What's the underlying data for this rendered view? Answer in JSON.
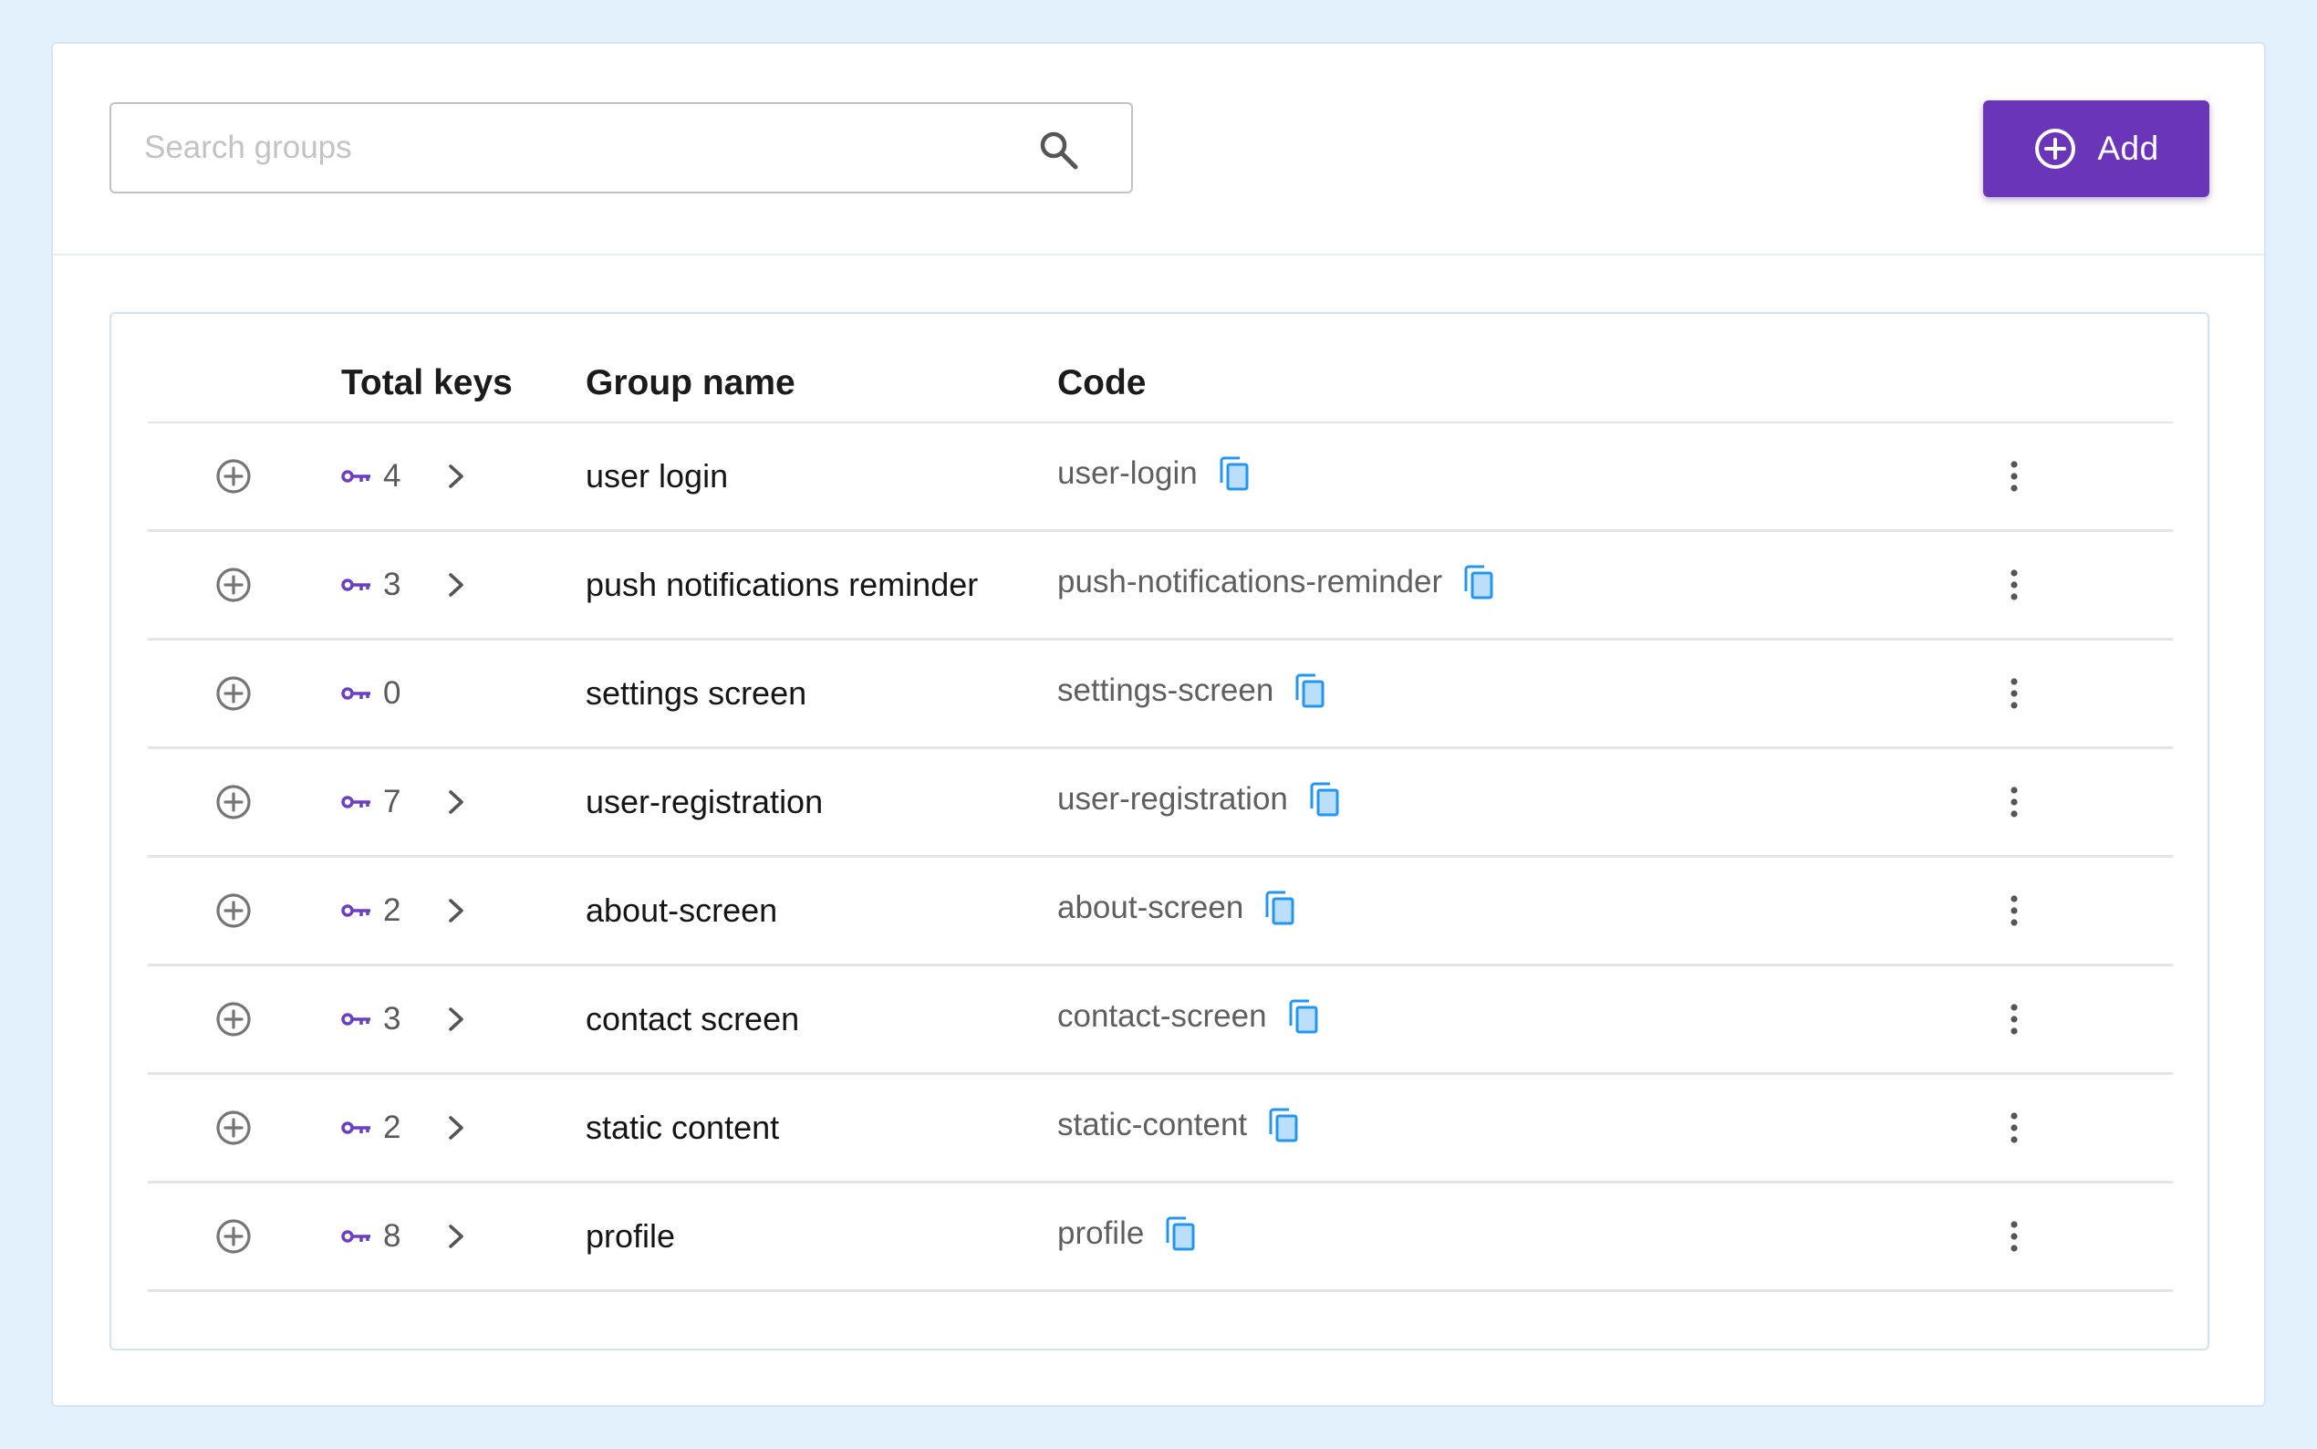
{
  "search": {
    "placeholder": "Search groups",
    "value": ""
  },
  "toolbar": {
    "add_label": "Add"
  },
  "colors": {
    "accent": "#6a35b8",
    "key_icon": "#6b3fc4",
    "copy_icon": "#2196f3",
    "background": "#e3f1fc"
  },
  "table": {
    "headers": {
      "total_keys": "Total keys",
      "group_name": "Group name",
      "code": "Code"
    },
    "rows": [
      {
        "total_keys": "4",
        "has_keys": true,
        "group_name": "user login",
        "code": "user-login"
      },
      {
        "total_keys": "3",
        "has_keys": true,
        "group_name": "push notifications reminder",
        "code": "push-notifications-reminder"
      },
      {
        "total_keys": "0",
        "has_keys": false,
        "group_name": "settings screen",
        "code": "settings-screen"
      },
      {
        "total_keys": "7",
        "has_keys": true,
        "group_name": "user-registration",
        "code": "user-registration"
      },
      {
        "total_keys": "2",
        "has_keys": true,
        "group_name": "about-screen",
        "code": "about-screen"
      },
      {
        "total_keys": "3",
        "has_keys": true,
        "group_name": "contact screen",
        "code": "contact-screen"
      },
      {
        "total_keys": "2",
        "has_keys": true,
        "group_name": "static content",
        "code": "static-content"
      },
      {
        "total_keys": "8",
        "has_keys": true,
        "group_name": "profile",
        "code": "profile"
      }
    ]
  },
  "icons": {
    "search": "search-icon",
    "add": "plus-circle-icon",
    "expand": "plus-circle-icon",
    "keys": "key-icon",
    "open": "chevron-right-icon",
    "copy": "copy-icon",
    "more": "more-vertical-icon"
  }
}
